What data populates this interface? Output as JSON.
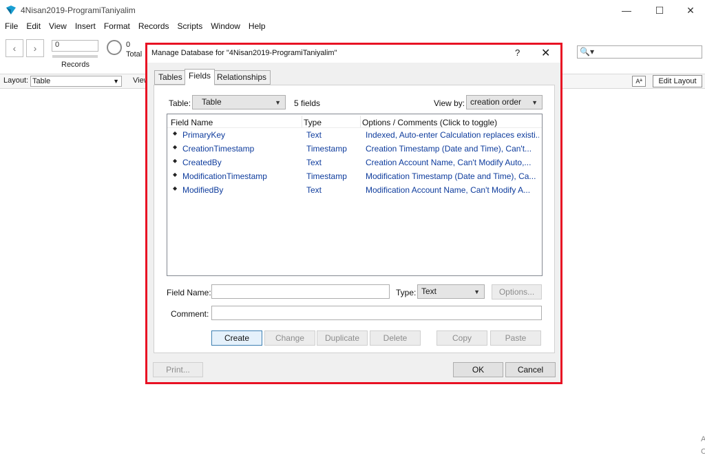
{
  "window": {
    "title": "4Nisan2019-ProgramiTaniyalim",
    "minimize": "—",
    "maximize": "☐",
    "close": "✕"
  },
  "menu": [
    "File",
    "Edit",
    "View",
    "Insert",
    "Format",
    "Records",
    "Scripts",
    "Window",
    "Help"
  ],
  "toolbar": {
    "prev": "‹",
    "next": "›",
    "record_value": "0",
    "records_label": "Records",
    "found_count": "0",
    "total_label": "Total",
    "search_icon": "🔍▾"
  },
  "layoutbar": {
    "layout_label": "Layout:",
    "layout_value": "Table",
    "view_label": "View",
    "font_size_label": "Aª",
    "edit_layout_label": "Edit Layout"
  },
  "dialog": {
    "title": "Manage Database for \"4Nisan2019-ProgramiTaniyalim\"",
    "help": "?",
    "close": "✕",
    "tabs": [
      "Tables",
      "Fields",
      "Relationships"
    ],
    "active_tab": "Fields",
    "table_label": "Table:",
    "table_value": "Table",
    "field_count": "5 fields",
    "view_by_label": "View by:",
    "view_by_value": "creation order",
    "columns": {
      "name": "Field Name",
      "type": "Type",
      "options": "Options / Comments   (Click to toggle)"
    },
    "fields": [
      {
        "name": "PrimaryKey",
        "type": "Text",
        "options": "Indexed, Auto-enter Calculation replaces existi..."
      },
      {
        "name": "CreationTimestamp",
        "type": "Timestamp",
        "options": "Creation Timestamp (Date and Time), Can't..."
      },
      {
        "name": "CreatedBy",
        "type": "Text",
        "options": "Creation Account Name, Can't Modify Auto,..."
      },
      {
        "name": "ModificationTimestamp",
        "type": "Timestamp",
        "options": "Modification Timestamp (Date and Time), Ca..."
      },
      {
        "name": "ModifiedBy",
        "type": "Text",
        "options": "Modification Account Name, Can't Modify A..."
      }
    ],
    "field_name_label": "Field Name:",
    "field_name_value": "",
    "type_label": "Type:",
    "type_value": "Text",
    "options_button": "Options...",
    "comment_label": "Comment:",
    "comment_value": "",
    "buttons": {
      "create": "Create",
      "change": "Change",
      "duplicate": "Duplicate",
      "delete": "Delete",
      "copy": "Copy",
      "paste": "Paste",
      "print": "Print...",
      "ok": "OK",
      "cancel": "Cancel"
    },
    "highlight_color": "#e81123"
  },
  "edge_glyphs": [
    "A",
    "C"
  ]
}
